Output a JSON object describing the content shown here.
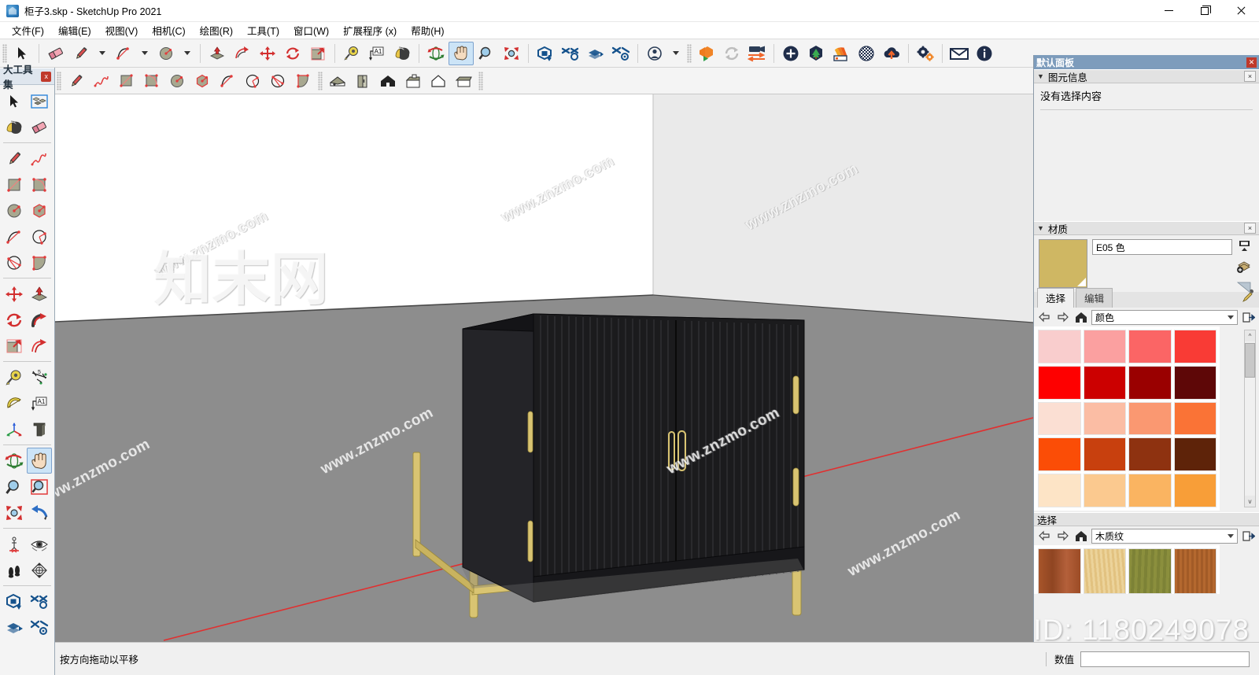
{
  "window": {
    "title": "柜子3.skp - SketchUp Pro 2021",
    "app_icon": "sketchup-icon",
    "minimize": "—",
    "maximize": "❐",
    "close": "✕"
  },
  "menu": {
    "items": [
      {
        "label": "文件(F)",
        "name": "menu-file"
      },
      {
        "label": "编辑(E)",
        "name": "menu-edit"
      },
      {
        "label": "视图(V)",
        "name": "menu-view"
      },
      {
        "label": "相机(C)",
        "name": "menu-camera"
      },
      {
        "label": "绘图(R)",
        "name": "menu-draw"
      },
      {
        "label": "工具(T)",
        "name": "menu-tools"
      },
      {
        "label": "窗口(W)",
        "name": "menu-window"
      },
      {
        "label": "扩展程序 (x)",
        "name": "menu-extensions"
      },
      {
        "label": "帮助(H)",
        "name": "menu-help"
      }
    ]
  },
  "toolbar_main": {
    "groups": [
      [
        "select-arrow-icon"
      ],
      [
        "eraser-icon",
        "pencil-icon",
        "pencil-dropdown-icon",
        "arc-icon",
        "arc-dropdown-icon",
        "circle-icon",
        "circle-dropdown-icon"
      ],
      [
        "pushpull-icon",
        "followme-icon",
        "move-icon",
        "rotate-icon",
        "scale-icon"
      ],
      [
        "tape-measure-icon",
        "text-tool-icon",
        "paint-bucket-icon"
      ],
      [
        "orbit-icon",
        "pan-icon",
        "zoom-icon",
        "zoom-extents-icon"
      ],
      [
        "solid-tools-icon",
        "outer-shell-icon",
        "intersect-icon",
        "subtract-icon"
      ],
      [
        "account-icon",
        "account-dropdown-icon"
      ],
      [
        "enscape-start-icon",
        "enscape-sync-icon",
        "enscape-video-icon"
      ],
      [
        "add-object-icon",
        "asset-library-icon",
        "materials-icon",
        "sphere-grid-icon",
        "cloud-upload-icon"
      ],
      [
        "settings-gears-icon"
      ],
      [
        "mail-icon",
        "info-icon"
      ]
    ],
    "active_tool": "pan-icon"
  },
  "toolbar_second": {
    "groups": [
      [
        "line-icon",
        "freehand-icon",
        "rectangle-icon",
        "rotated-rectangle-icon",
        "circle2-icon",
        "polygon-icon",
        "arc2-icon",
        "two-point-arc-icon",
        "three-point-arc-icon",
        "pie-icon"
      ],
      [
        "iso-view-icon",
        "front-panel-view-icon",
        "home-view-icon",
        "top-view-icon",
        "front-view-icon",
        "back-view-icon"
      ]
    ]
  },
  "left_palette": {
    "title": "大工具集",
    "close_label": "x",
    "active_tool": "pan-tool",
    "tools": [
      "select-arrow-icon",
      "make-component-icon",
      "paint-bucket-icon",
      "eraser-icon",
      "DIV",
      "pencil-icon",
      "freehand-icon",
      "rectangle-icon",
      "rotated-rectangle-icon",
      "circle-icon",
      "polygon-icon",
      "arc-icon",
      "two-point-arc-icon",
      "three-point-arc-icon",
      "pie-icon",
      "DIV",
      "move-icon",
      "pushpull-icon",
      "rotate-icon",
      "followme-icon",
      "scale-icon",
      "offset-icon",
      "DIV",
      "tape-measure-icon",
      "dimension-icon",
      "protractor-icon",
      "text-tool-icon",
      "axes-icon",
      "three-d-text-icon",
      "DIV",
      "orbit-icon",
      "pan-icon",
      "zoom-icon",
      "zoom-window-icon",
      "zoom-extents-icon",
      "previous-view-icon",
      "DIV",
      "position-camera-icon",
      "look-around-icon",
      "walk-icon",
      "section-plane-icon",
      "DIV",
      "solid-tools-icon",
      "outer-shell-icon",
      "split-icon",
      "trim-icon"
    ]
  },
  "viewport": {
    "model_name": "黑色竖纹柜子",
    "wall_color": "#ffffff",
    "floor_color": "#8d8d8d",
    "cabinet_body_color": "#1b1b1d",
    "cabinet_side_color": "#232327",
    "cabinet_top_color": "#121214",
    "gold_color": "#d7c271",
    "axis_red_color": "#e03030",
    "watermarks": [
      "www.znzmo.com",
      "www.znzmo.com",
      "www.znzmo.com",
      "www.znzmo.com",
      "www.znzmo.com",
      "www.znzmo.com",
      "www.znzmo.com"
    ],
    "watermark_cn": "知末网",
    "watermark_id": "ID: 1180249078"
  },
  "status_bar": {
    "message": "按方向拖动以平移",
    "vcb_label": "数值",
    "vcb_value": ""
  },
  "tray": {
    "title": "默认面板",
    "close_label": "✕",
    "entity_info": {
      "title": "图元信息",
      "collapse_arrow": "▼",
      "close_label": "×",
      "message": "没有选择内容"
    },
    "materials": {
      "title": "材质",
      "collapse_arrow": "▼",
      "close_label": "×",
      "swatch_color": "#cfb763",
      "name": "E05 色",
      "side_icons": [
        "display-options-icon",
        "create-material-icon",
        "back-face-icon"
      ],
      "tabs": [
        {
          "label": "选择",
          "active": true
        },
        {
          "label": "编辑",
          "active": false
        }
      ],
      "eyedropper": "eyedropper-icon",
      "nav": [
        "back-arrow-icon",
        "forward-arrow-icon",
        "home-icon"
      ],
      "library_selected": "颜色",
      "detail_icon": "details-arrow-icon",
      "color_swatches": [
        "#f9cdcd",
        "#fba0a0",
        "#fb6565",
        "#f93b35",
        "#fe0000",
        "#cc0000",
        "#9a0000",
        "#5e0707",
        "#fbdfd3",
        "#fbbda4",
        "#fa9871",
        "#fa7336",
        "#fb4d06",
        "#c8400e",
        "#8e3210",
        "#5e2309",
        "#fde4c6",
        "#fbc98f",
        "#fab461",
        "#f89e38"
      ],
      "scrollbar": {
        "up": "^",
        "down": "v"
      }
    },
    "select_section": {
      "title": "选择",
      "nav": [
        "back-arrow-icon",
        "forward-arrow-icon",
        "home-icon"
      ],
      "library_selected": "木质纹",
      "detail_icon": "details-arrow-icon",
      "wood_swatches": [
        "#a8552a",
        "#ecd39a",
        "#8b8f3d",
        "#b4682f"
      ]
    }
  }
}
